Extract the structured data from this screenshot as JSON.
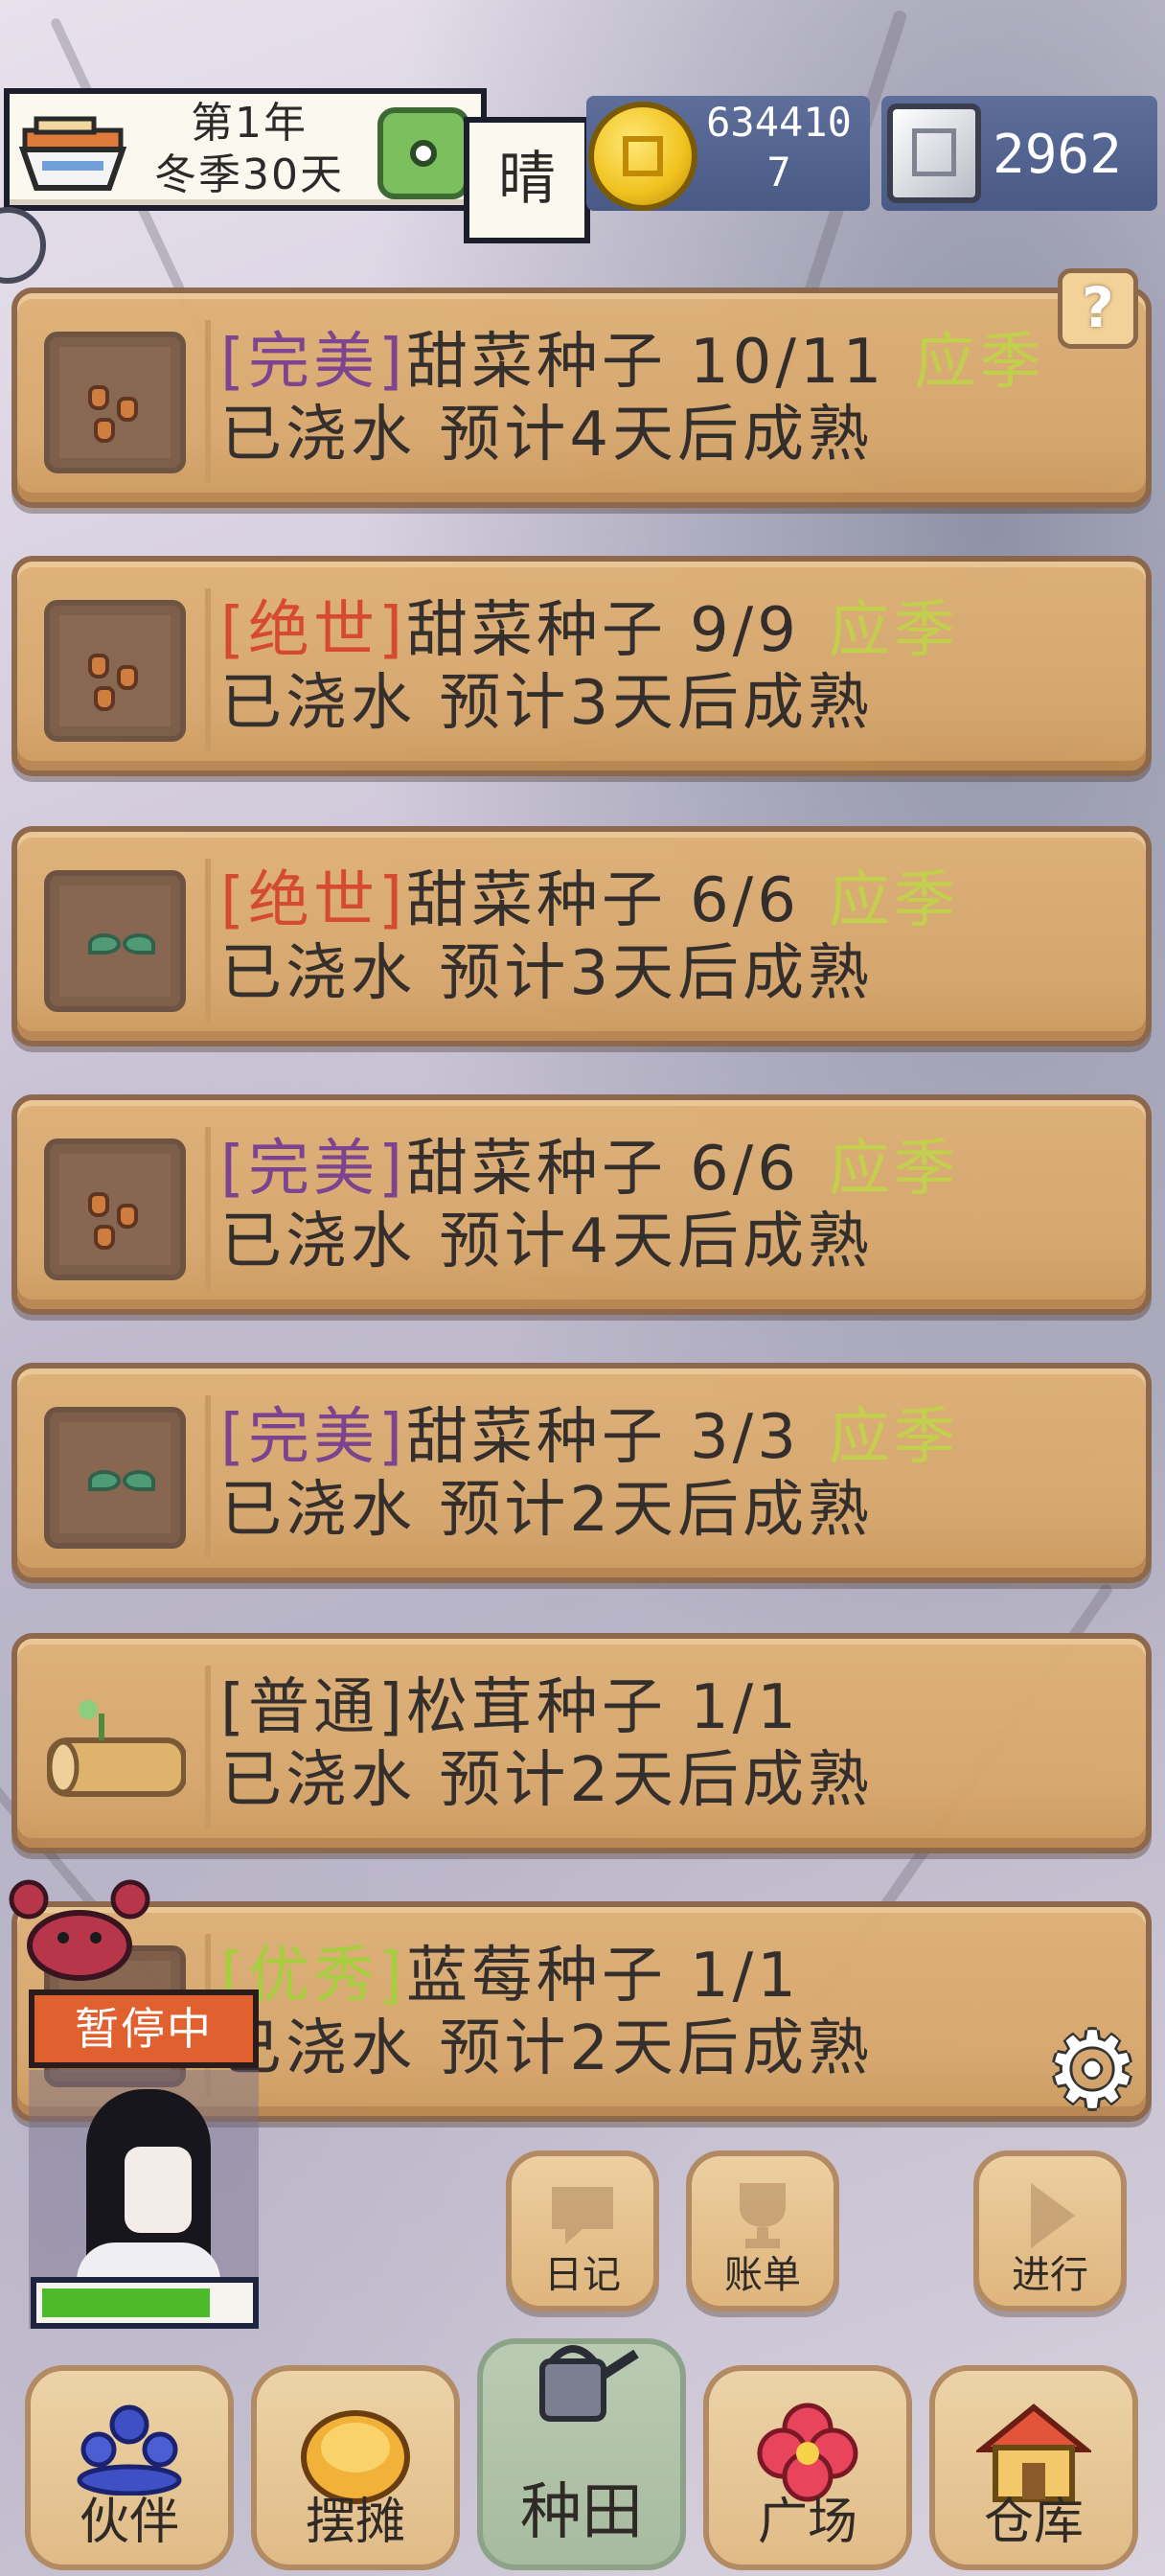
{
  "header": {
    "year_label": "第1年",
    "season_label": "冬季30天",
    "weather": "晴",
    "gold": "6344107",
    "silver": "2962"
  },
  "help_label": "?",
  "crops": [
    {
      "quality": "[完美]",
      "quality_type": "perfect",
      "name": "甜菜种子",
      "count": "10/11",
      "season": "应季",
      "status": "已浇水 预计4天后成熟",
      "icon": "seed"
    },
    {
      "quality": "[绝世]",
      "quality_type": "unique",
      "name": "甜菜种子",
      "count": "9/9",
      "season": "应季",
      "status": "已浇水 预计3天后成熟",
      "icon": "seed"
    },
    {
      "quality": "[绝世]",
      "quality_type": "unique",
      "name": "甜菜种子",
      "count": "6/6",
      "season": "应季",
      "status": "已浇水 预计3天后成熟",
      "icon": "sprout"
    },
    {
      "quality": "[完美]",
      "quality_type": "perfect",
      "name": "甜菜种子",
      "count": "6/6",
      "season": "应季",
      "status": "已浇水 预计4天后成熟",
      "icon": "seed"
    },
    {
      "quality": "[完美]",
      "quality_type": "perfect",
      "name": "甜菜种子",
      "count": "3/3",
      "season": "应季",
      "status": "已浇水 预计2天后成熟",
      "icon": "sprout"
    },
    {
      "quality": "[普通]",
      "quality_type": "common",
      "name": "松茸种子",
      "count": "1/1",
      "season": "",
      "status": "已浇水 预计2天后成熟",
      "icon": "log"
    },
    {
      "quality": "[优秀]",
      "quality_type": "good",
      "name": "蓝莓种子",
      "count": "1/1",
      "season": "",
      "status": "已浇水 预计2天后成熟",
      "icon": "sprout"
    }
  ],
  "character": {
    "status": "暂停中",
    "hp_fraction": 0.82
  },
  "actions": {
    "diary": "日记",
    "ledger": "账单",
    "proceed": "进行"
  },
  "nav": {
    "partner": "伙伴",
    "stall": "摆摊",
    "farm": "种田",
    "plaza": "广场",
    "warehouse": "仓库"
  },
  "colors": {
    "card": "#d8a86d",
    "perfect": "#7a3f8c",
    "unique": "#d6452c",
    "good": "#a6cf3a",
    "season": "#c4d24a",
    "pause": "#e06030"
  }
}
